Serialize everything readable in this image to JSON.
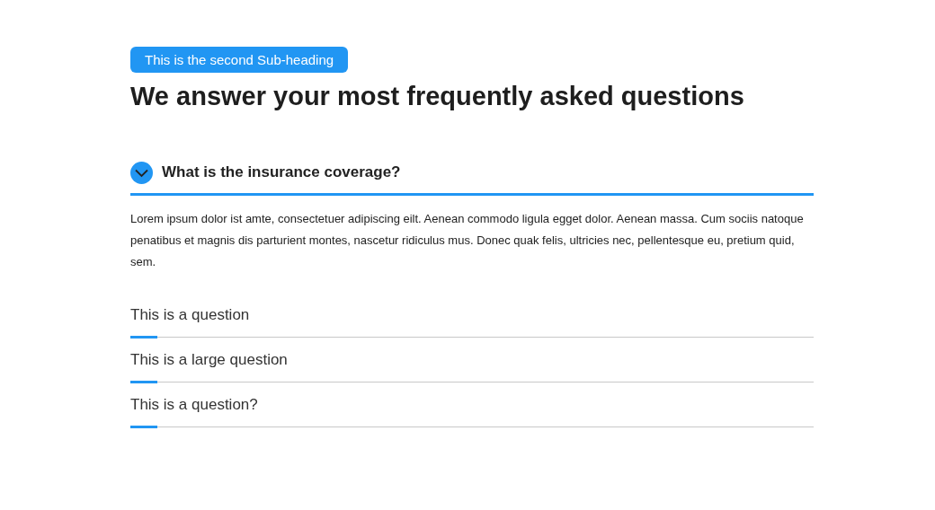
{
  "badge": "This is the second Sub-heading",
  "heading": "We answer your most frequently asked questions",
  "faq": [
    {
      "question": "What is the insurance coverage?",
      "expanded": true,
      "answer": "Lorem ipsum dolor ist amte, consectetuer adipiscing eilt. Aenean commodo ligula egget dolor. Aenean massa. Cum sociis natoque penatibus et magnis dis parturient montes, nascetur ridiculus mus. Donec quak felis, ultricies nec, pellentesque eu, pretium quid, sem."
    },
    {
      "question": "This is a question",
      "expanded": false
    },
    {
      "question": "This is a large question",
      "expanded": false
    },
    {
      "question": "This is a question?",
      "expanded": false
    }
  ]
}
